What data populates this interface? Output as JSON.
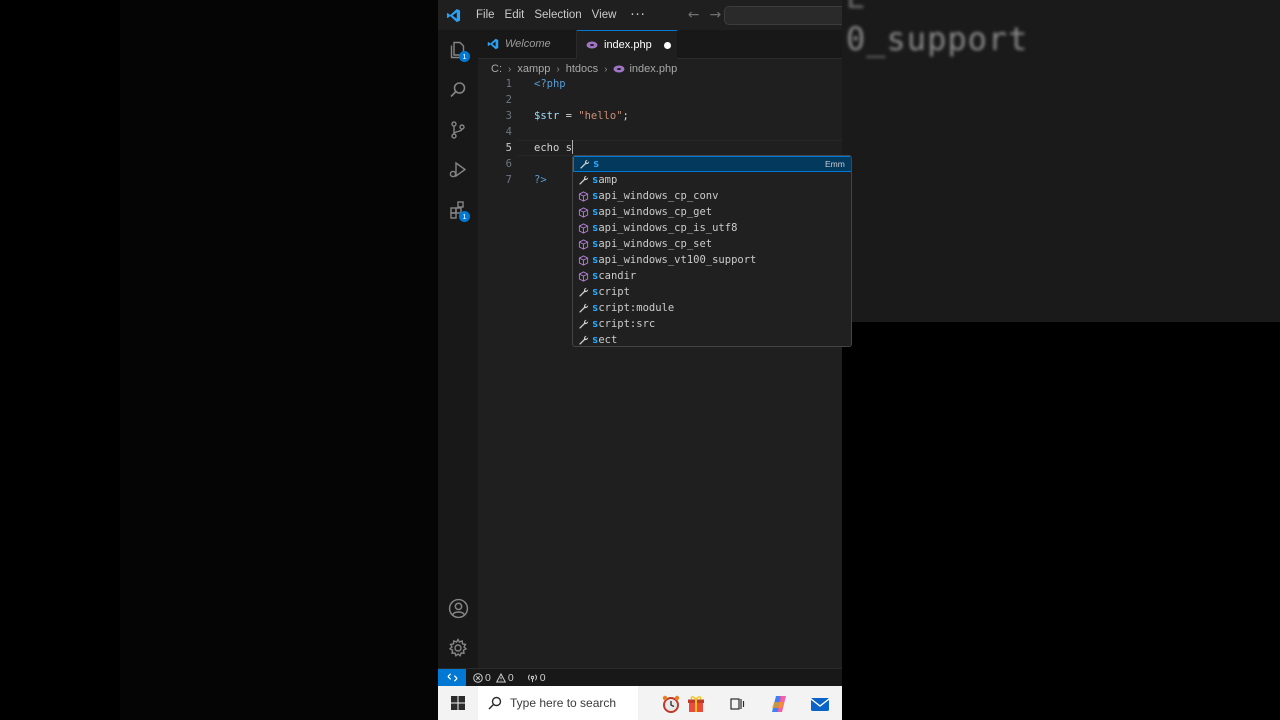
{
  "background": {
    "blurred_text_top": "E",
    "blurred_text": "0_support"
  },
  "titlebar": {
    "menus": [
      "File",
      "Edit",
      "Selection",
      "View"
    ],
    "more": "···",
    "back_icon": "arrow-left-icon",
    "forward_icon": "arrow-right-icon"
  },
  "activity_bar": {
    "items": [
      {
        "name": "explorer",
        "icon": "files-icon",
        "badge": "1"
      },
      {
        "name": "search",
        "icon": "search-icon"
      },
      {
        "name": "source-control",
        "icon": "source-control-icon"
      },
      {
        "name": "run-debug",
        "icon": "run-debug-icon"
      },
      {
        "name": "extensions",
        "icon": "extensions-icon",
        "badge": "1"
      }
    ],
    "bottom": [
      {
        "name": "accounts",
        "icon": "account-icon"
      },
      {
        "name": "manage",
        "icon": "gear-icon"
      }
    ]
  },
  "tabs": [
    {
      "label": "Welcome",
      "icon": "vscode-icon",
      "active": false
    },
    {
      "label": "index.php",
      "icon": "php-icon",
      "active": true,
      "modified": true
    }
  ],
  "breadcrumb": [
    "C:",
    "xampp",
    "htdocs",
    "index.php"
  ],
  "editor": {
    "lines": [
      {
        "n": "1",
        "text": "<?php"
      },
      {
        "n": "2",
        "text": ""
      },
      {
        "n": "3",
        "var": "$str",
        "op": " = ",
        "str": "\"hello\"",
        "end": ";"
      },
      {
        "n": "4",
        "text": ""
      },
      {
        "n": "5",
        "kw": "echo",
        "rest": " s"
      },
      {
        "n": "6",
        "text": ""
      },
      {
        "n": "7",
        "text": "?>"
      }
    ],
    "active_line": "5"
  },
  "suggestions": {
    "items": [
      {
        "label": "s",
        "match": "s",
        "rest": "",
        "kind": "wrench-icon",
        "detail": "Emm"
      },
      {
        "label": "samp",
        "match": "s",
        "rest": "amp",
        "kind": "wrench-icon"
      },
      {
        "label": "sapi_windows_cp_conv",
        "match": "s",
        "rest": "api_windows_cp_conv",
        "kind": "cube-icon"
      },
      {
        "label": "sapi_windows_cp_get",
        "match": "s",
        "rest": "api_windows_cp_get",
        "kind": "cube-icon"
      },
      {
        "label": "sapi_windows_cp_is_utf8",
        "match": "s",
        "rest": "api_windows_cp_is_utf8",
        "kind": "cube-icon"
      },
      {
        "label": "sapi_windows_cp_set",
        "match": "s",
        "rest": "api_windows_cp_set",
        "kind": "cube-icon"
      },
      {
        "label": "sapi_windows_vt100_support",
        "match": "s",
        "rest": "api_windows_vt100_support",
        "kind": "cube-icon"
      },
      {
        "label": "scandir",
        "match": "s",
        "rest": "candir",
        "kind": "cube-icon"
      },
      {
        "label": "script",
        "match": "s",
        "rest": "cript",
        "kind": "wrench-icon"
      },
      {
        "label": "script:module",
        "match": "s",
        "rest": "cript:module",
        "kind": "wrench-icon"
      },
      {
        "label": "script:src",
        "match": "s",
        "rest": "cript:src",
        "kind": "wrench-icon"
      },
      {
        "label": "sect",
        "match": "s",
        "rest": "ect",
        "kind": "wrench-icon"
      }
    ]
  },
  "statusbar": {
    "errors": "0",
    "warnings": "0",
    "ports": "0"
  },
  "taskbar": {
    "search_placeholder": "Type here to search"
  },
  "colors": {
    "accent": "#0078d4",
    "editor_bg": "#1f1f1f",
    "sidebar_bg": "#181818"
  }
}
